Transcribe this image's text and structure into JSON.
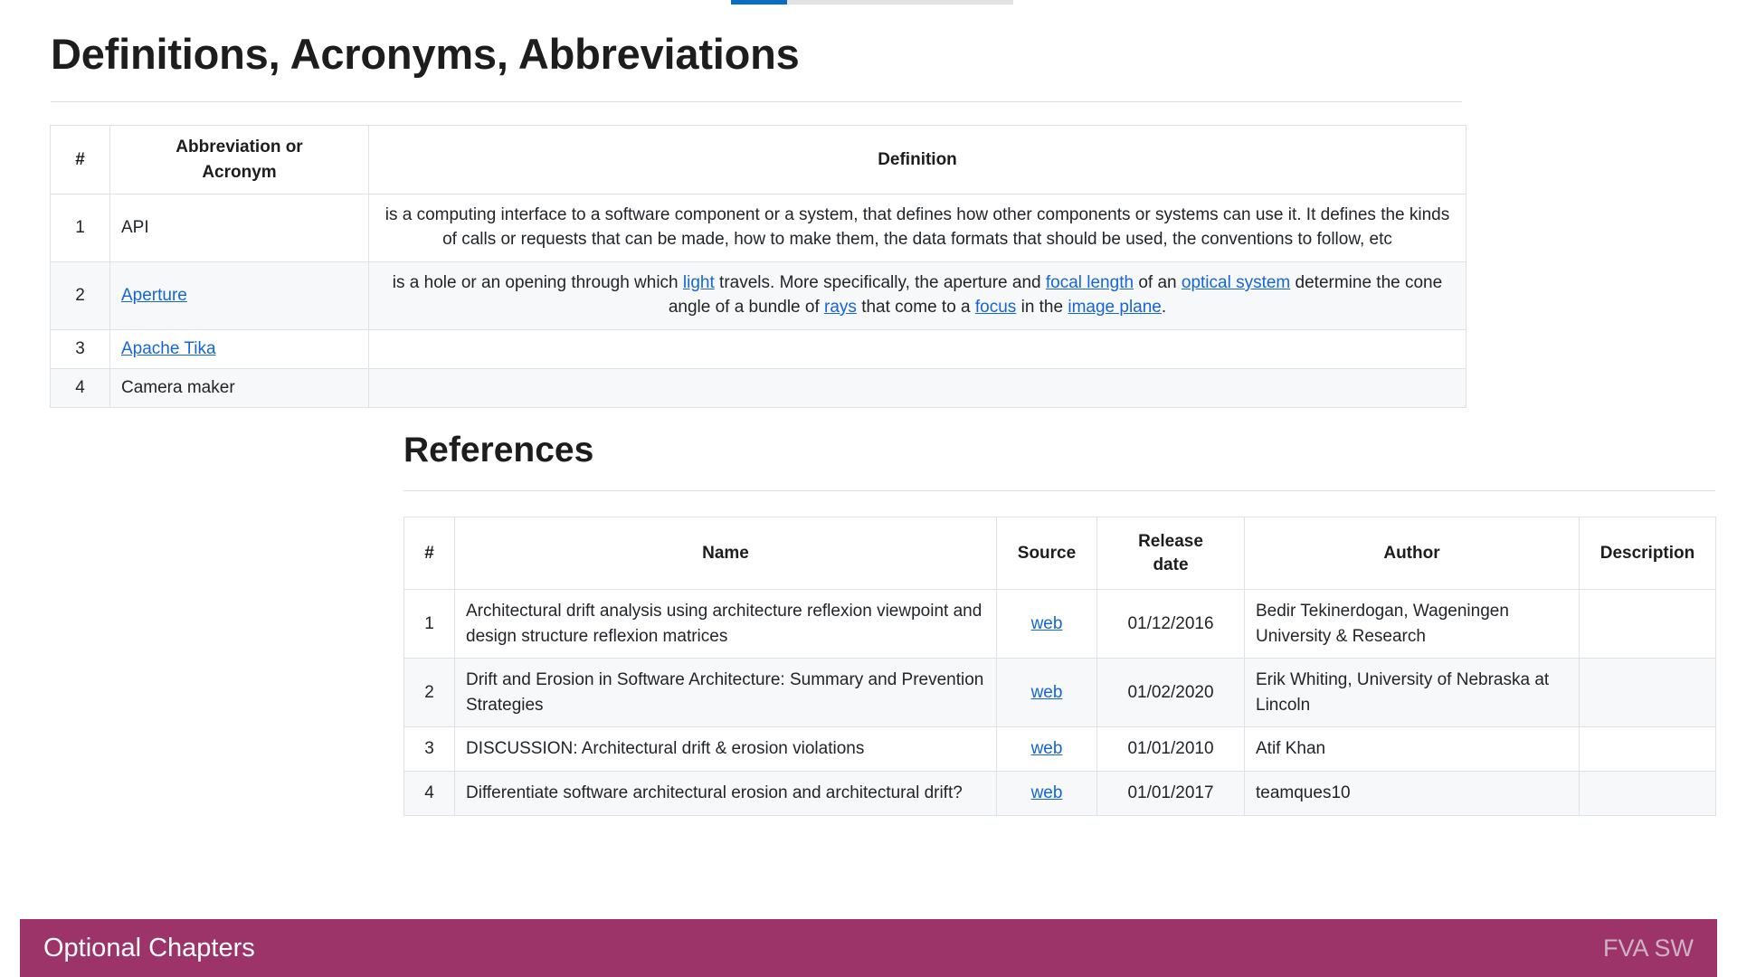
{
  "top_progress": {
    "fill_color": "#0b6cc4",
    "track_color": "#e3e3e3"
  },
  "definitions_section": {
    "title": "Definitions, Acronyms, Abbreviations",
    "table": {
      "headers": [
        "#",
        "Abbreviation or Acronym",
        "Definition"
      ],
      "header_abbr_line1": "Abbreviation or",
      "header_abbr_line2": "Acronym",
      "rows": [
        {
          "num": "1",
          "term": "API",
          "term_is_link": false,
          "definition_plain": "is a computing interface to a software component or a system, that defines how other components or systems can use it. It defines the kinds of calls or requests that can be made, how to make them, the data formats that should be used, the conventions to follow, etc",
          "definition_parts": [
            {
              "text": "is a computing interface to a software component or a system, that defines how other components or systems can use it. It defines the kinds of calls or requests that can be made, how to make them, the data formats that should be used, the conventions to follow, etc",
              "link": false
            }
          ]
        },
        {
          "num": "2",
          "term": "Aperture",
          "term_is_link": true,
          "definition_plain": "is a hole or an opening through which light travels. More specifically, the aperture and focal length of an optical system determine the cone angle of a bundle of rays that come to a focus in the image plane.",
          "definition_parts": [
            {
              "text": "is a hole or an opening through which ",
              "link": false
            },
            {
              "text": "light",
              "link": true
            },
            {
              "text": " travels. More specifically, the aperture and ",
              "link": false
            },
            {
              "text": "focal length",
              "link": true
            },
            {
              "text": " of an ",
              "link": false
            },
            {
              "text": "optical system",
              "link": true
            },
            {
              "text": " determine the cone angle of a bundle of ",
              "link": false
            },
            {
              "text": "rays",
              "link": true
            },
            {
              "text": " that come to a ",
              "link": false
            },
            {
              "text": "focus",
              "link": true
            },
            {
              "text": " in the ",
              "link": false
            },
            {
              "text": "image plane",
              "link": true
            },
            {
              "text": ".",
              "link": false
            }
          ]
        },
        {
          "num": "3",
          "term": "Apache Tika",
          "term_is_link": true,
          "definition_plain": "",
          "definition_parts": []
        },
        {
          "num": "4",
          "term": "Camera maker",
          "term_is_link": false,
          "definition_plain": "",
          "definition_parts": []
        }
      ]
    }
  },
  "references_section": {
    "title": "References",
    "table": {
      "headers": [
        "#",
        "Name",
        "Source",
        "Release date",
        "Author",
        "Description"
      ],
      "header_date_line1": "Release",
      "header_date_line2": "date",
      "rows": [
        {
          "num": "1",
          "name": "Architectural drift analysis using architecture reflexion viewpoint and design structure reflexion matrices",
          "source": "web",
          "release_date": "01/12/2016",
          "author": "Bedir Tekinerdogan, Wageningen University & Research",
          "description": ""
        },
        {
          "num": "2",
          "name": "Drift and Erosion in Software Architecture: Summary and Prevention Strategies",
          "source": "web",
          "release_date": "01/02/2020",
          "author": "Erik Whiting, University of Nebraska at Lincoln",
          "description": ""
        },
        {
          "num": "3",
          "name": "DISCUSSION: Architectural drift & erosion violations",
          "source": "web",
          "release_date": "01/01/2010",
          "author": "Atif Khan",
          "description": ""
        },
        {
          "num": "4",
          "name": "Differentiate software architectural erosion and architectural drift?",
          "source": "web",
          "release_date": "01/01/2017",
          "author": "teamques10",
          "description": ""
        }
      ]
    }
  },
  "footer": {
    "left_label": "Optional Chapters",
    "right_label": "FVA SW",
    "background_color": "#9c3369",
    "left_text_color": "#ffffff",
    "right_text_color": "#cdb3c2"
  }
}
